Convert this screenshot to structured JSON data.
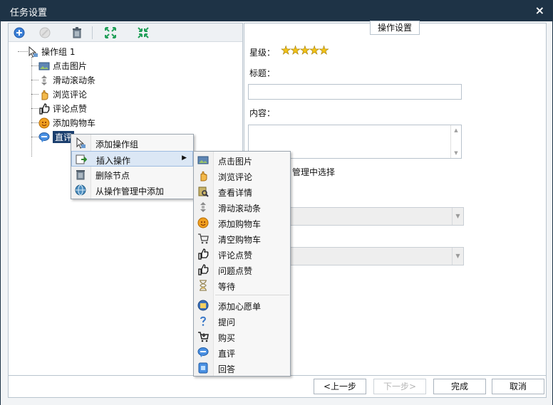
{
  "window": {
    "title": "任务设置",
    "close_label": "×"
  },
  "toolbar": {
    "add": "add-icon",
    "disabled": "disabled-icon",
    "delete": "trash-icon",
    "expand": "expand-icon",
    "collapse": "collapse-icon"
  },
  "tree": {
    "root": "操作组 1",
    "children": [
      "点击图片",
      "滑动滚动条",
      "浏览评论",
      "评论点赞",
      "添加购物车",
      "直评"
    ]
  },
  "form": {
    "tab": "操作设置",
    "star_label": "星级：",
    "stars": "★★★★★",
    "title_label": "标题：",
    "content_label": "内容：",
    "obscured_text": "管理中选择"
  },
  "context_menu": {
    "items": [
      "添加操作组",
      "插入操作",
      "删除节点",
      "从操作管理中添加"
    ],
    "submenu_arrow": "▶"
  },
  "submenu": {
    "items": [
      "点击图片",
      "浏览评论",
      "查看详情",
      "滑动滚动条",
      "添加购物车",
      "清空购物车",
      "评论点赞",
      "问题点赞",
      "等待",
      "添加心愿单",
      "提问",
      "购买",
      "直评",
      "回答"
    ]
  },
  "buttons": {
    "prev": "<上一步",
    "next": "下一步>",
    "finish": "完成",
    "cancel": "取消"
  }
}
